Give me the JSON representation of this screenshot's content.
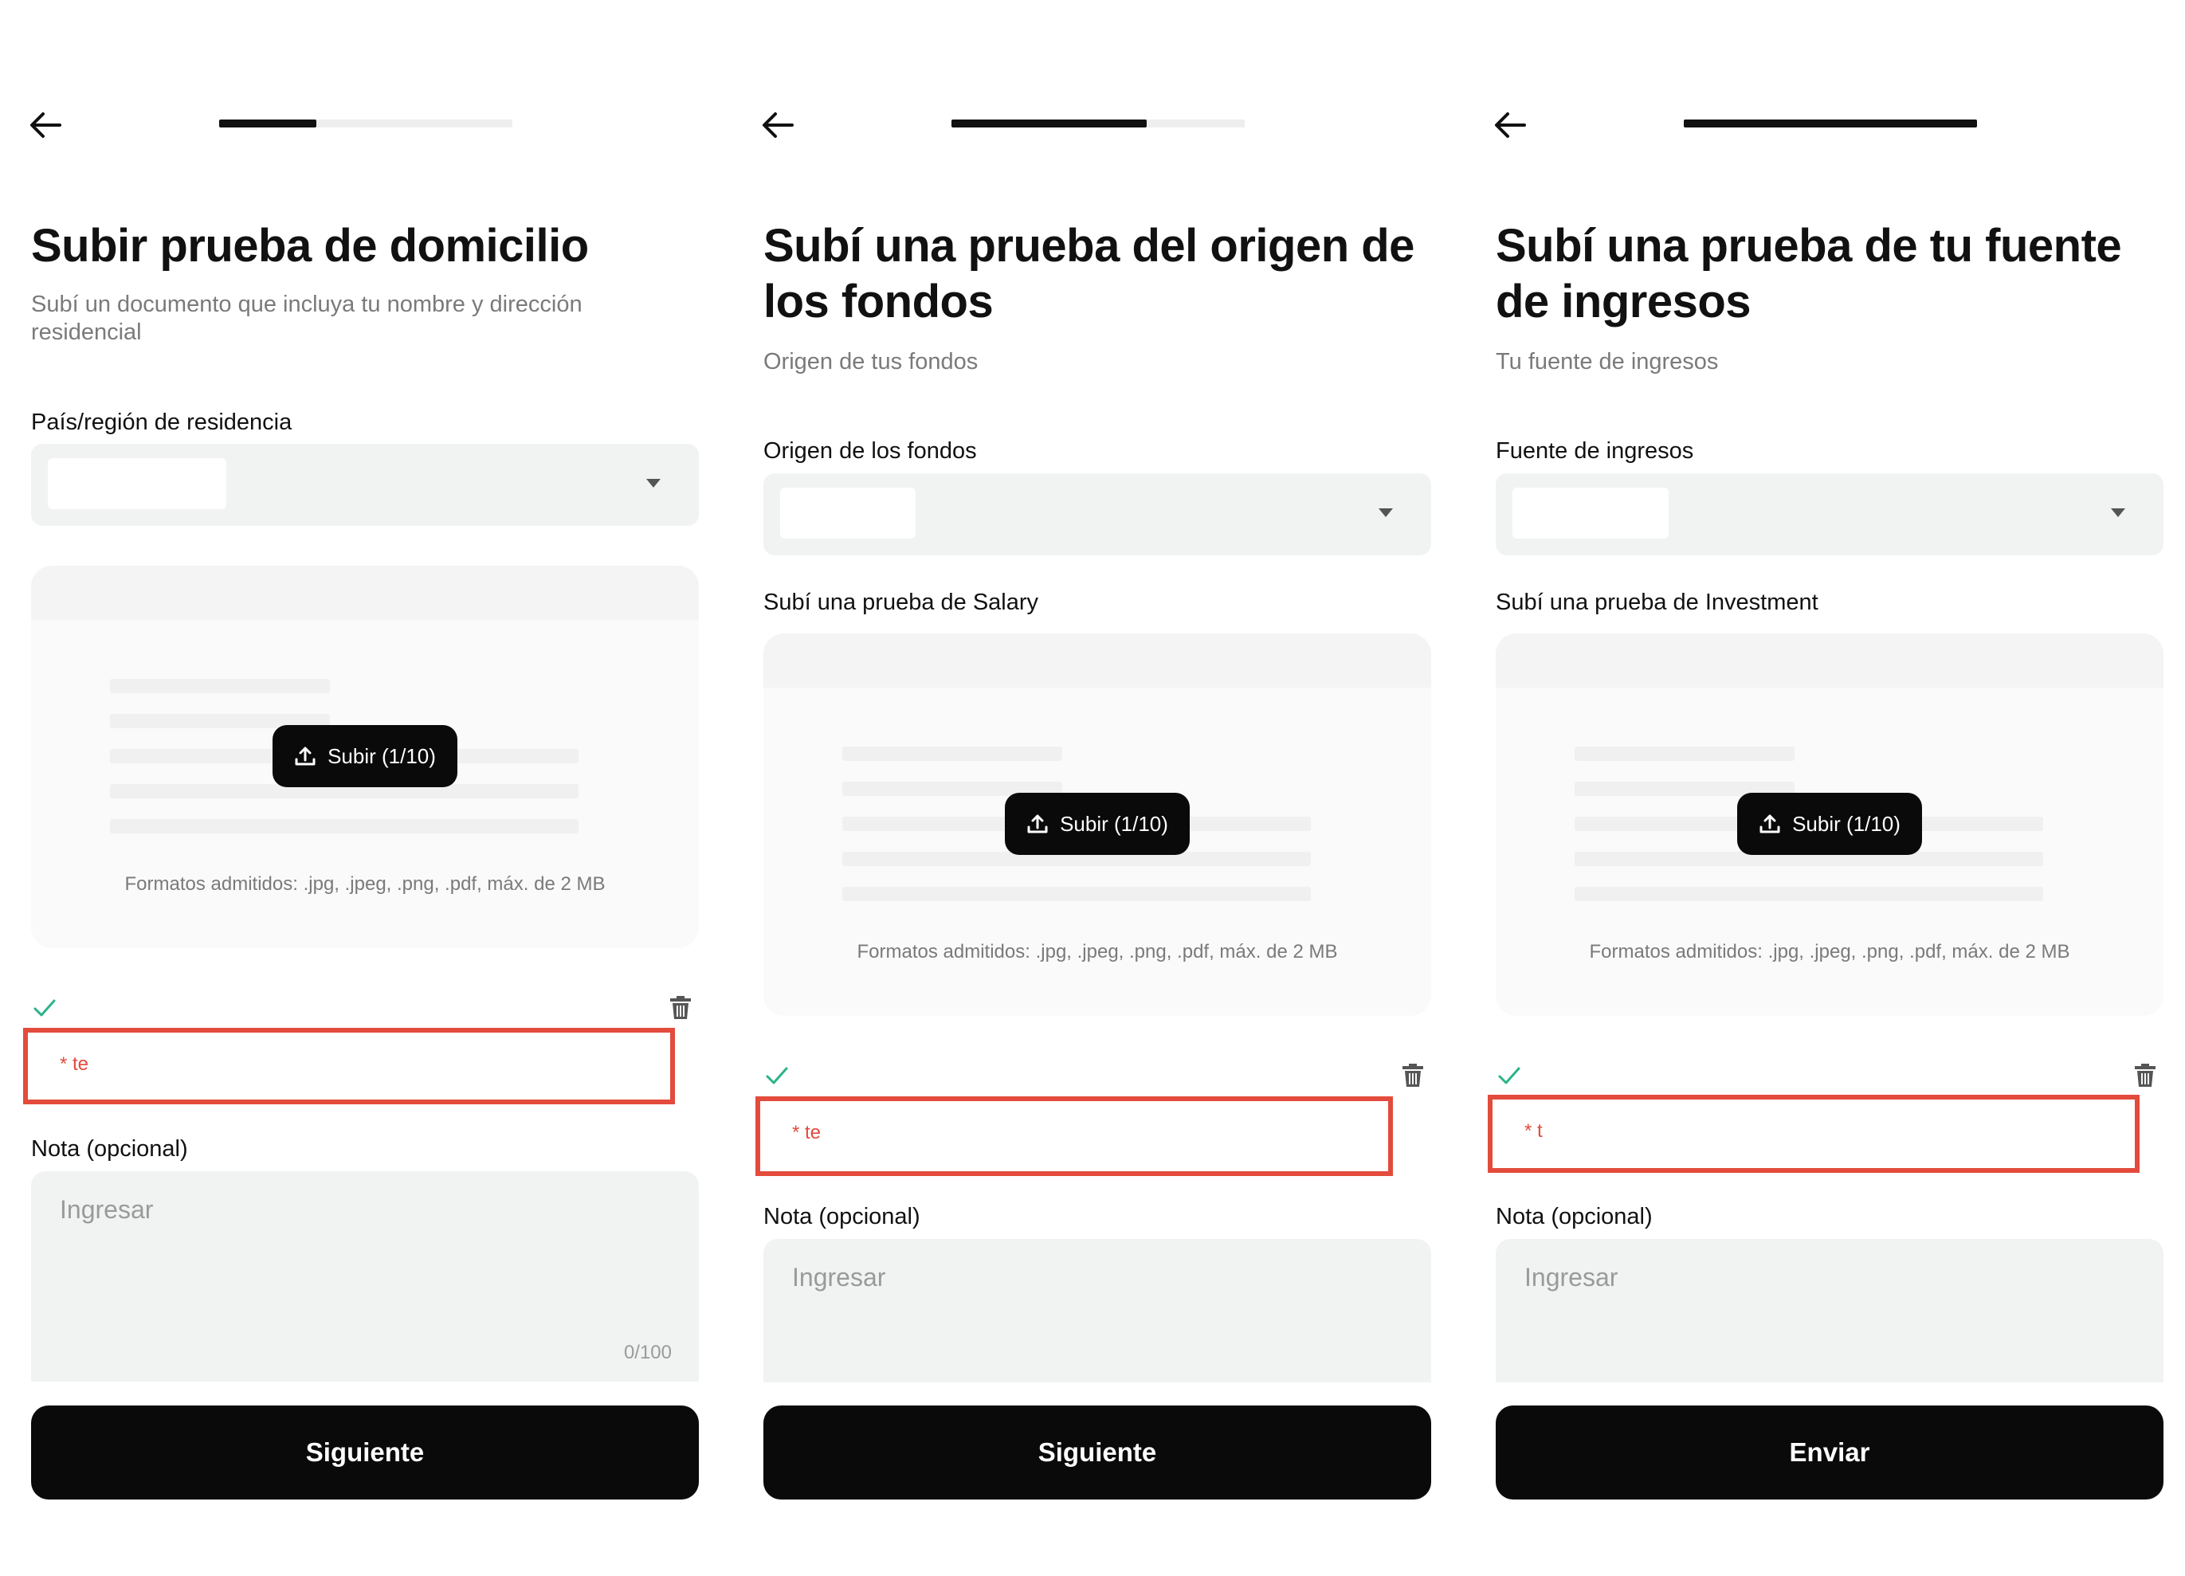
{
  "screens": [
    {
      "back_icon": "arrow-left-icon",
      "progress": 0.33,
      "title": "Subir prueba de domicilio",
      "subtitle": "Subí un documento que incluya tu nombre y dirección residencial",
      "select_label": "País/región de residencia",
      "upload_label": "",
      "upload_button": "Subir (1/10)",
      "formats": "Formatos admitidos: .jpg, .jpeg, .png, .pdf, máx. de 2 MB",
      "file_name": "* te",
      "note_label": "Nota (opcional)",
      "note_placeholder": "Ingresar",
      "note_counter": "0/100",
      "primary_button": "Siguiente"
    },
    {
      "back_icon": "arrow-left-icon",
      "progress": 0.67,
      "title": "Subí una prueba del origen de los fondos",
      "subtitle": "Origen de tus fondos",
      "select_label": "Origen de los fondos",
      "upload_label": "Subí una prueba de Salary",
      "upload_button": "Subir (1/10)",
      "formats": "Formatos admitidos: .jpg, .jpeg, .png, .pdf, máx. de 2 MB",
      "file_name": "* te",
      "note_label": "Nota (opcional)",
      "note_placeholder": "Ingresar",
      "note_counter": "",
      "primary_button": "Siguiente"
    },
    {
      "back_icon": "arrow-left-icon",
      "progress": 1.0,
      "title": "Subí una prueba de tu fuente de ingresos",
      "subtitle": "Tu fuente de ingresos",
      "select_label": "Fuente de ingresos",
      "upload_label": "Subí una prueba de Investment",
      "upload_button": "Subir (1/10)",
      "formats": "Formatos admitidos: .jpg, .jpeg, .png, .pdf, máx. de 2 MB",
      "file_name": "* t",
      "note_label": "Nota (opcional)",
      "note_placeholder": "Ingresar",
      "note_counter": "",
      "primary_button": "Enviar"
    }
  ],
  "icons": [
    "arrow-left-icon",
    "chevron-down-icon",
    "upload-icon",
    "check-icon",
    "trash-icon"
  ],
  "colors": {
    "primary": "#0a0a0a",
    "field_bg": "#f1f3f3",
    "highlight": "#e34b3c",
    "success": "#2bb38a",
    "muted_text": "#7a7a7a"
  }
}
